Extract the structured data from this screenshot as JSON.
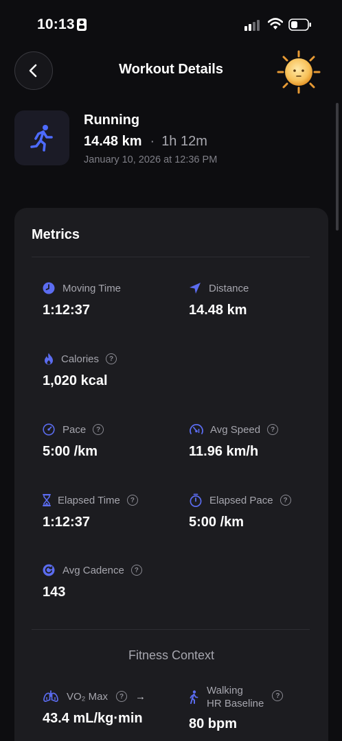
{
  "status_bar": {
    "time": "10:13"
  },
  "header": {
    "title": "Workout Details"
  },
  "workout": {
    "activity": "Running",
    "distance": "14.48 km",
    "separator": "·",
    "duration": "1h 12m",
    "date": "January 10, 2026 at 12:36 PM"
  },
  "metrics": {
    "title": "Metrics",
    "moving_time": {
      "label": "Moving Time",
      "value": "1:12:37"
    },
    "distance": {
      "label": "Distance",
      "value": "14.48 km"
    },
    "calories": {
      "label": "Calories",
      "value": "1,020 kcal"
    },
    "pace": {
      "label": "Pace",
      "value": "5:00 /km"
    },
    "avg_speed": {
      "label": "Avg Speed",
      "value": "11.96 km/h"
    },
    "elapsed_time": {
      "label": "Elapsed Time",
      "value": "1:12:37"
    },
    "elapsed_pace": {
      "label": "Elapsed Pace",
      "value": "5:00 /km"
    },
    "avg_cadence": {
      "label": "Avg Cadence",
      "value": "143"
    }
  },
  "fitness_context": {
    "title": "Fitness Context",
    "vo2max": {
      "label": "VO₂ Max",
      "value": "43.4 mL/kg·min"
    },
    "walking_hr": {
      "label_line1": "Walking",
      "label_line2": "HR Baseline",
      "value": "80 bpm"
    }
  },
  "icons": {
    "help": "?",
    "arrow": "→"
  },
  "colors": {
    "accent": "#5b6cf0",
    "background": "#0d0d10",
    "card": "#1c1c20"
  }
}
